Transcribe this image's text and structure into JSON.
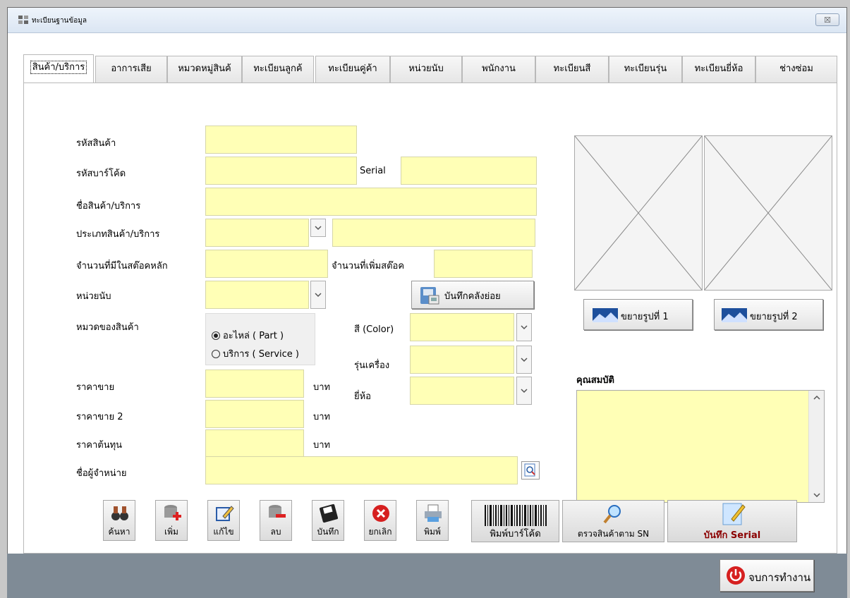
{
  "window": {
    "title": "ทะเบียนฐานข้อมูล",
    "close_symbol": "☒"
  },
  "tabs": [
    {
      "label": "สินค้า/บริการ",
      "active": true
    },
    {
      "label": "อาการเสีย"
    },
    {
      "label": "หมวดหมู่สินค้"
    },
    {
      "label": "ทะเบียนลูกค้"
    },
    {
      "label": "ทะเบียนคู่ค้า"
    },
    {
      "label": "หน่วยนับ"
    },
    {
      "label": "พนักงาน"
    },
    {
      "label": "ทะเบียนสี"
    },
    {
      "label": "ทะเบียนรุ่น"
    },
    {
      "label": "ทะเบียนยี่ห้อ"
    },
    {
      "label": "ช่างซ่อม"
    }
  ],
  "form": {
    "product_code_label": "รหัสสินค้า",
    "barcode_label": "รหัสบาร์โค้ด",
    "serial_label": "Serial",
    "product_name_label": "ชื่อสินค้า/บริการ",
    "product_type_label": "ประเภทสินค้า/บริการ",
    "main_stock_label": "จำนวนที่มีในสต๊อคหลัก",
    "add_stock_label": "จำนวนที่เพิ่มสต๊อค",
    "unit_label": "หน่วยนับ",
    "save_substock_label": "บันทึกคลังย่อย",
    "category_label": "หมวดของสินค้า",
    "radio_part": "อะไหล่ ( Part )",
    "radio_service": "บริการ ( Service )",
    "color_label": "สี (Color)",
    "model_label": "รุ่นเครื่อง",
    "brand_label": "ยี่ห้อ",
    "price_label": "ราคาขาย",
    "price2_label": "ราคาขาย 2",
    "cost_label": "ราคาต้นทุน",
    "currency": "บาท",
    "supplier_label": "ชื่อผู้จำหน่าย",
    "properties_label": "คุณสมบัติ",
    "enlarge1_label": "ขยายรูปที่ 1",
    "enlarge2_label": "ขยายรูปที่ 2"
  },
  "toolbar": {
    "search": "ค้นหา",
    "add": "เพิ่ม",
    "edit": "แก้ไข",
    "delete": "ลบ",
    "save": "บันทึก",
    "cancel": "ยกเลิก",
    "print": "พิมพ์",
    "print_barcode": "พิมพ์บาร์โค้ด",
    "check_sn": "ตรวจสินค้าตาม SN",
    "save_serial": "บันทึก Serial"
  },
  "exit_label": "จบการทำงาน",
  "colors": {
    "field_bg": "#ffffb6",
    "accent_red": "#d62020",
    "save_serial_text": "#8b0000"
  }
}
